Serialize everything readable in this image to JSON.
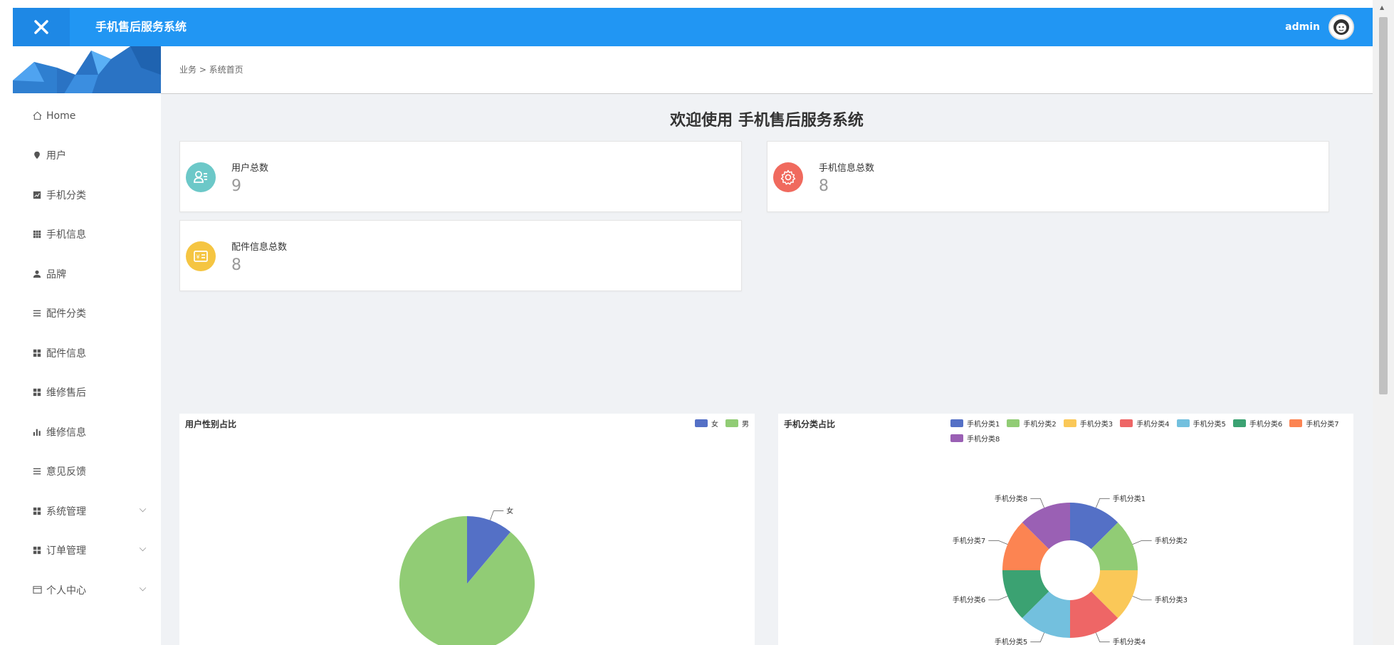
{
  "header": {
    "app_title": "手机售后服务系统",
    "username": "admin",
    "color": "#2196f3"
  },
  "sidebar": {
    "items": [
      {
        "label": "Home",
        "icon": "home-icon"
      },
      {
        "label": "用户",
        "icon": "pin-icon"
      },
      {
        "label": "手机分类",
        "icon": "chart-square-icon"
      },
      {
        "label": "手机信息",
        "icon": "grid-icon"
      },
      {
        "label": "品牌",
        "icon": "person-icon"
      },
      {
        "label": "配件分类",
        "icon": "list-icon"
      },
      {
        "label": "配件信息",
        "icon": "apps-icon"
      },
      {
        "label": "维修售后",
        "icon": "apps-icon"
      },
      {
        "label": "维修信息",
        "icon": "bar-chart-icon"
      },
      {
        "label": "意见反馈",
        "icon": "list-icon"
      },
      {
        "label": "系统管理",
        "icon": "apps-icon",
        "expandable": true
      },
      {
        "label": "订单管理",
        "icon": "apps-icon",
        "expandable": true
      },
      {
        "label": "个人中心",
        "icon": "window-icon",
        "expandable": true
      }
    ]
  },
  "breadcrumb": "业务 > 系统首页",
  "welcome": "欢迎使用 手机售后服务系统",
  "stats": [
    {
      "label": "用户总数",
      "value": "9",
      "color": "#6cc8c8",
      "icon": "user-card-icon"
    },
    {
      "label": "手机信息总数",
      "value": "8",
      "color": "#f06a5e",
      "icon": "gear-icon"
    },
    {
      "label": "配件信息总数",
      "value": "8",
      "color": "#f5c542",
      "icon": "price-tag-icon"
    }
  ],
  "chart_data": [
    {
      "type": "pie",
      "title": "用户性别占比",
      "categories": [
        "女",
        "男"
      ],
      "values": [
        1,
        8
      ],
      "colors": [
        "#5470c6",
        "#91cc75"
      ],
      "legend": "top-right"
    },
    {
      "type": "pie",
      "title": "手机分类占比",
      "categories": [
        "手机分类1",
        "手机分类2",
        "手机分类3",
        "手机分类4",
        "手机分类5",
        "手机分类6",
        "手机分类7",
        "手机分类8"
      ],
      "values": [
        1,
        1,
        1,
        1,
        1,
        1,
        1,
        1
      ],
      "colors": [
        "#5470c6",
        "#91cc75",
        "#fac858",
        "#ee6666",
        "#73c0de",
        "#3ba272",
        "#fc8452",
        "#9a60b4"
      ],
      "legend": "top-right",
      "donut": true
    }
  ]
}
